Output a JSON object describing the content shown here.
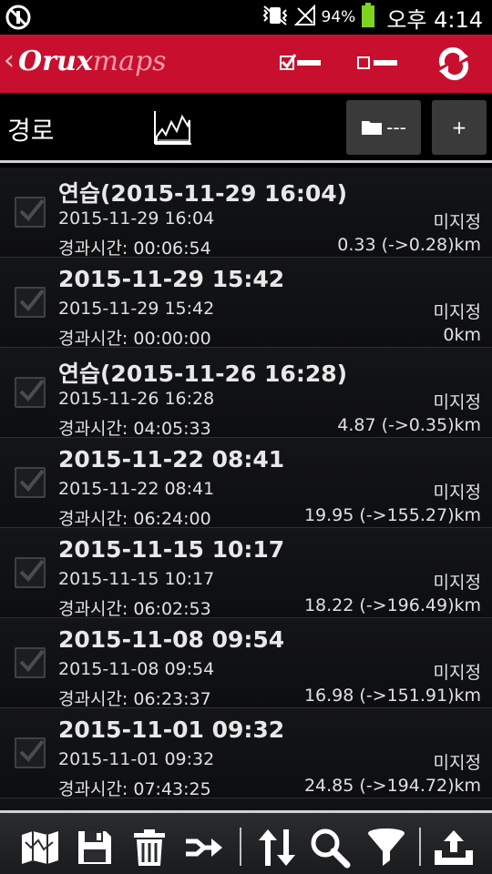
{
  "status_bar": {
    "battery_text": "94%",
    "time": "오후 4:14",
    "battery_level": 0.94,
    "battery_color": "#7ed321"
  },
  "app_bar": {
    "logo_part1": "Orux",
    "logo_part2": "maps",
    "background": "#c8102e"
  },
  "header": {
    "title": "경로",
    "folder_label": "---",
    "plus_label": "+"
  },
  "tracks": [
    {
      "title": "연습(2015-11-29 16:04)",
      "date": "2015-11-29 16:04",
      "type": "미지정",
      "duration": "경과시간: 00:06:54",
      "distance": "0.33 (->0.28)km"
    },
    {
      "title": "2015-11-29 15:42",
      "date": "2015-11-29 15:42",
      "type": "미지정",
      "duration": "경과시간: 00:00:00",
      "distance": "0km"
    },
    {
      "title": "연습(2015-11-26 16:28)",
      "date": "2015-11-26 16:28",
      "type": "미지정",
      "duration": "경과시간: 04:05:33",
      "distance": "4.87 (->0.35)km"
    },
    {
      "title": "2015-11-22 08:41",
      "date": "2015-11-22 08:41",
      "type": "미지정",
      "duration": "경과시간: 06:24:00",
      "distance": "19.95 (->155.27)km"
    },
    {
      "title": "2015-11-15 10:17",
      "date": "2015-11-15 10:17",
      "type": "미지정",
      "duration": "경과시간: 06:02:53",
      "distance": "18.22 (->196.49)km"
    },
    {
      "title": "2015-11-08 09:54",
      "date": "2015-11-08 09:54",
      "type": "미지정",
      "duration": "경과시간: 06:23:37",
      "distance": "16.98 (->151.91)km"
    },
    {
      "title": "2015-11-01 09:32",
      "date": "2015-11-01 09:32",
      "type": "미지정",
      "duration": "경과시간: 07:43:25",
      "distance": "24.85 (->194.72)km"
    }
  ],
  "toolbar_icons": [
    "map-icon",
    "save-icon",
    "trash-icon",
    "merge-icon",
    "sort-icon",
    "search-icon",
    "filter-icon",
    "upload-icon"
  ]
}
